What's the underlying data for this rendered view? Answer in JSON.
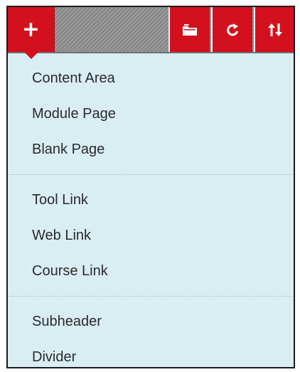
{
  "toolbar": {
    "add_button_glyph": "+",
    "icons": [
      "plus-icon",
      "folder-icon",
      "refresh-icon",
      "sort-icon"
    ],
    "colors": {
      "accent": "#d3101e",
      "toolbar_bg": "#8f8f8f",
      "menu_bg": "#d9eef3",
      "text": "#2a2a2a"
    }
  },
  "menu": {
    "groups": [
      {
        "items": [
          {
            "label": "Content Area"
          },
          {
            "label": "Module Page"
          },
          {
            "label": "Blank Page"
          }
        ]
      },
      {
        "items": [
          {
            "label": "Tool Link"
          },
          {
            "label": "Web Link"
          },
          {
            "label": "Course Link"
          }
        ]
      },
      {
        "items": [
          {
            "label": "Subheader"
          },
          {
            "label": "Divider"
          }
        ]
      }
    ]
  }
}
